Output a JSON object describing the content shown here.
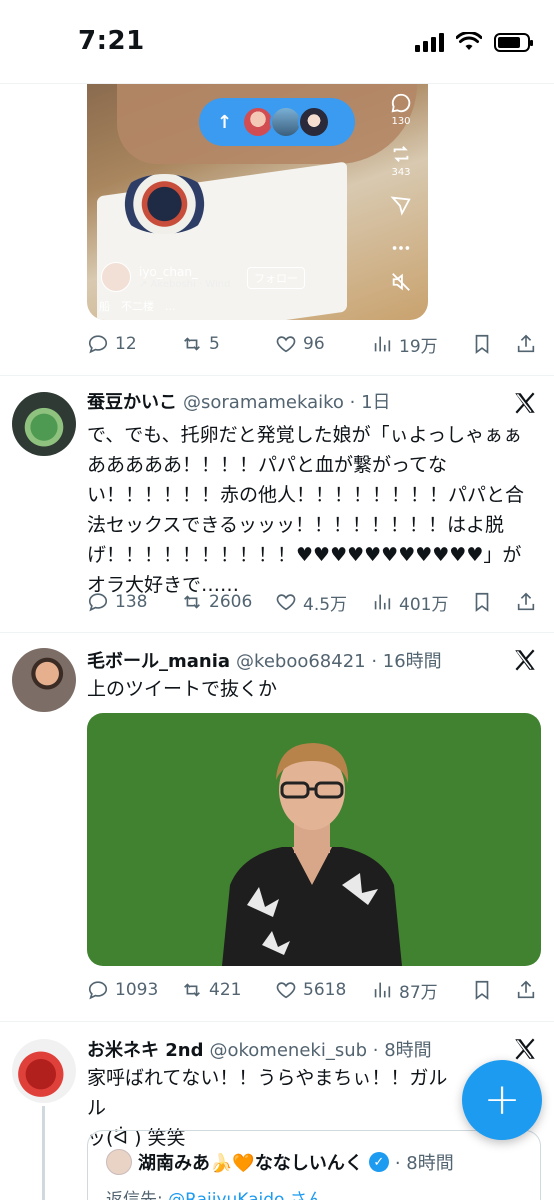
{
  "status_bar": {
    "time": "7:21"
  },
  "new_posts_pill": {
    "arrow": "↑",
    "avatars": [
      "avatar-1",
      "avatar-2",
      "avatar-3"
    ]
  },
  "video_post": {
    "username": "iyo_chan_",
    "music": "↗ Akeboshi · Wind",
    "follow": "フォロー",
    "caption": "船　不二楼　...",
    "side_counts": {
      "comments": "130",
      "reposts": "343"
    },
    "actions": {
      "replies": "12",
      "reposts": "5",
      "likes": "96",
      "views": "19万"
    }
  },
  "tweets": [
    {
      "name": "蚕豆かいこ",
      "handle": "@soramamekaiko · 1日",
      "text": "で、でも、托卵だと発覚した娘が「ぃよっしゃぁぁあああああ！！！！パパと血が繋がってない！！！！！！赤の他人！！！！！！！！パパと合法セックスできるッッッ！！！！！！！！はよ脱げ！！！！！！！！！！♥♥♥♥♥♥♥♥♥♥♥」がオラ大好きで……",
      "actions": {
        "replies": "138",
        "reposts": "2606",
        "likes": "4.5万",
        "views": "401万"
      }
    },
    {
      "name": "毛ボール_mania",
      "handle": "@keboo68421 · 16時間",
      "text": "上のツイートで抜くか",
      "actions": {
        "replies": "1093",
        "reposts": "421",
        "likes": "5618",
        "views": "87万"
      }
    },
    {
      "name": "お米ネキ 2nd",
      "handle": "@okomeneki_sub · 8時間",
      "text": "家呼ばれてない！！うらやまちぃ！！ガルル\nッ(ᐛ ) 笑笑",
      "quote": {
        "name": "湖南みあ🍌🧡ななしいんく",
        "time": "· 8時間",
        "reply_prefix": "返信先: ",
        "reply_mention": "@RaijyuKaido さん"
      }
    }
  ],
  "fab": {
    "label": "+"
  },
  "colors": {
    "accent": "#1d9bf0",
    "muted": "#536471",
    "green_screen": "#418231"
  }
}
